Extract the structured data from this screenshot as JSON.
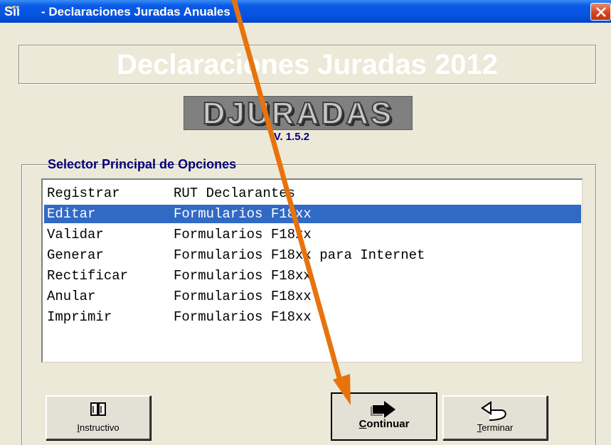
{
  "window": {
    "title": "- Declaraciones Juradas Anuales",
    "app_icon_text": "Sii"
  },
  "banner": {
    "title": "Declaraciones Juradas 2012"
  },
  "logo": {
    "text": "DJURADAS",
    "version": "V. 1.5.2"
  },
  "selector": {
    "label": "Selector Principal de Opciones",
    "items": [
      {
        "action": "Registrar",
        "target": "RUT Declarantes",
        "selected": false
      },
      {
        "action": "Editar",
        "target": "Formularios F18xx",
        "selected": true
      },
      {
        "action": "Validar",
        "target": "Formularios F18xx",
        "selected": false
      },
      {
        "action": "Generar",
        "target": "Formularios F18xx para Internet",
        "selected": false
      },
      {
        "action": "Rectificar",
        "target": "Formularios F18xx",
        "selected": false
      },
      {
        "action": "Anular",
        "target": "Formularios F18xx",
        "selected": false
      },
      {
        "action": "Imprimir",
        "target": "Formularios F18xx",
        "selected": false
      }
    ]
  },
  "buttons": {
    "instructivo": {
      "mnemonic": "I",
      "rest": "nstructivo"
    },
    "continuar": {
      "mnemonic": "C",
      "rest": "ontinuar"
    },
    "terminar": {
      "mnemonic": "T",
      "rest": "erminar"
    }
  },
  "annotation": {
    "arrow_color": "#e8720c"
  },
  "colors": {
    "titlebar": "#0554e0",
    "selection": "#316ac5",
    "label_navy": "#000080"
  }
}
